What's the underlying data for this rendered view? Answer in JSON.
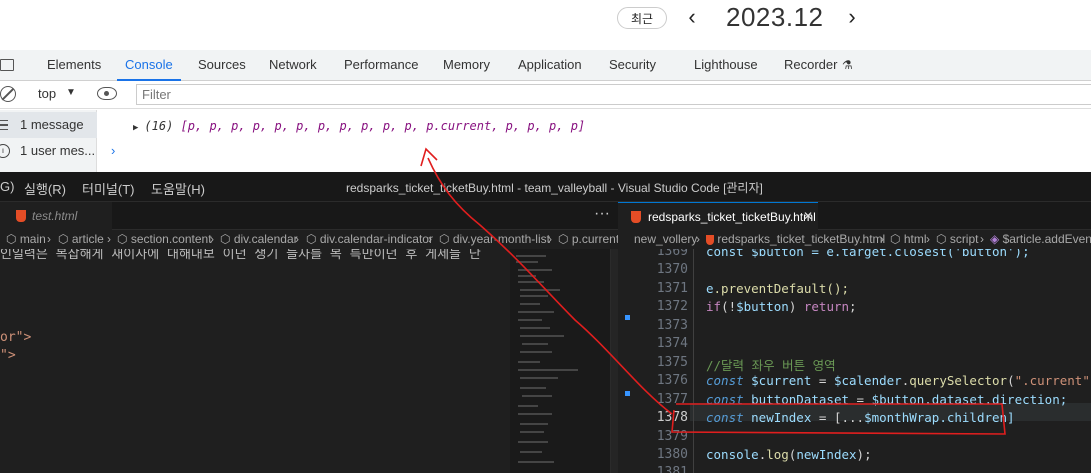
{
  "calendar": {
    "recent_label": "최근",
    "prev_label": "‹",
    "next_label": "›",
    "year_month": "2023.12"
  },
  "devtools": {
    "tabs": [
      "Elements",
      "Console",
      "Sources",
      "Network",
      "Performance",
      "Memory",
      "Application",
      "Security",
      "Lighthouse",
      "Recorder"
    ],
    "active_tab": "Console",
    "context": "top",
    "filter_placeholder": "Filter",
    "sidebar": [
      {
        "label": "1 message"
      },
      {
        "label": "1 user mes..."
      }
    ],
    "log": {
      "count": "(16)",
      "items": "[p, p, p, p, p, p, p, p, p, p, p, p.current, p, p, p, p]"
    },
    "prompt_symbol": "›"
  },
  "vscode": {
    "menu": [
      "G)",
      "실행(R)",
      "터미널(T)",
      "도움말(H)"
    ],
    "window_title": "redsparks_ticket_ticketBuy.html - team_valleyball - Visual Studio Code [관리자]",
    "left_tab": "test.html",
    "right_tab": "redsparks_ticket_ticketBuy.html",
    "left_breadcrumbs": [
      "main",
      "article",
      "section.content",
      "div.calendar",
      "div.calendar-indicator",
      "div.year-month-list",
      "p.current"
    ],
    "right_breadcrumbs": [
      "new_vollery",
      "redsparks_ticket_ticketBuy.html",
      "html",
      "script",
      "$article.addEventL"
    ],
    "left_code": [
      {
        "text": "인일력은 복잡해게 새이사에 대해내보 이던 생기 들자를 복 특만이던 후 게세들 단"
      },
      {
        "text": "or\">"
      },
      {
        "text": "\">"
      }
    ],
    "line_numbers": [
      "1369",
      "1370",
      "1371",
      "1372",
      "1373",
      "1374",
      "1375",
      "1376",
      "1377",
      "1378",
      "1379",
      "1380",
      "1381"
    ],
    "current_line": "1378",
    "code": {
      "l1369": "const $button = e.target.closest('button');",
      "l1371_a": "e",
      "l1371_b": ".preventDefault();",
      "l1372_a": "if",
      "l1372_b": "(!",
      "l1372_c": "$button",
      "l1372_d": ") ",
      "l1372_e": "return",
      "l1372_f": ";",
      "l1375": "//달력 좌우 버튼 영역",
      "l1376_a": "const ",
      "l1376_b": "$current",
      "l1376_c": " = ",
      "l1376_d": "$calender",
      "l1376_e": ".",
      "l1376_f": "querySelector",
      "l1376_g": "(",
      "l1376_h": "\".current\"",
      "l1376_i": ");",
      "l1377_a": "const ",
      "l1377_b": "buttonDataset",
      "l1377_c": " = ",
      "l1377_d": "$button",
      "l1377_e": ".dataset.direction;",
      "l1378_a": "const ",
      "l1378_b": "newIndex",
      "l1378_c": " = [...",
      "l1378_d": "$monthWrap",
      "l1378_e": ".children]",
      "l1380_a": "console",
      "l1380_b": ".",
      "l1380_c": "log",
      "l1380_d": "(",
      "l1380_e": "newIndex",
      "l1380_f": ");"
    }
  },
  "colors": {
    "accent_blue": "#1a73e8",
    "annotation_red": "#e01e1e",
    "vscode_bg": "#1f1f1f"
  }
}
